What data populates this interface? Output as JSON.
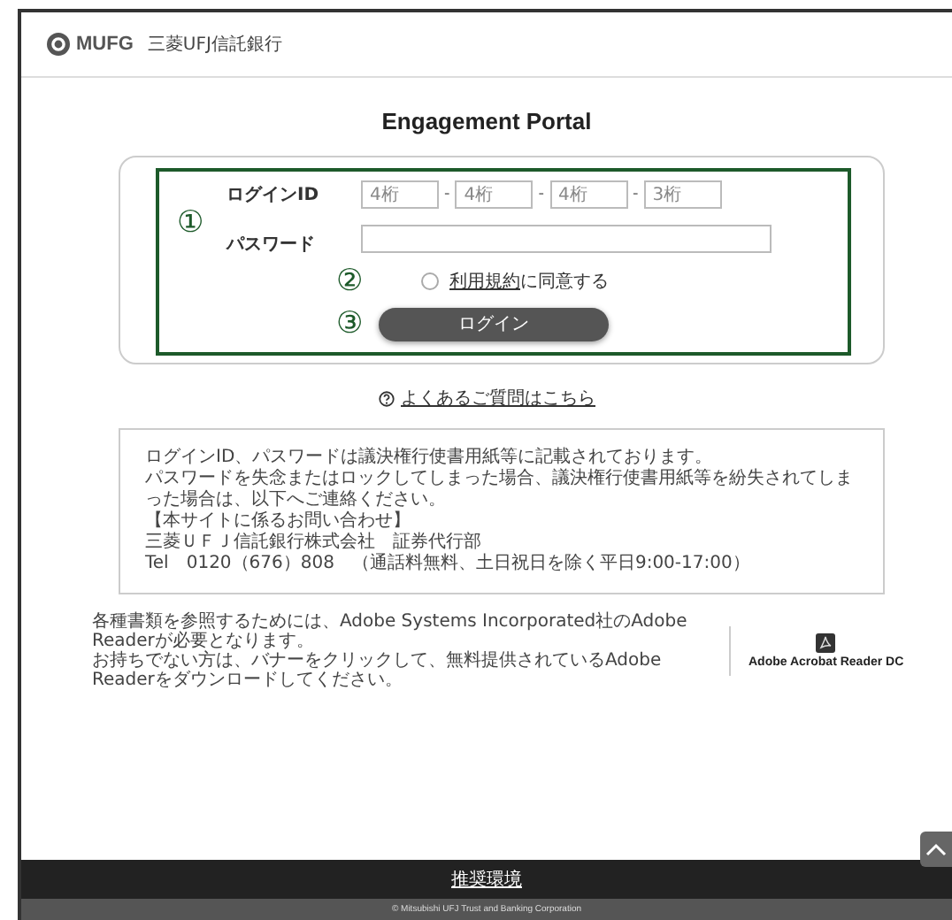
{
  "header": {
    "logo_text": "MUFG",
    "bank_name": "三菱UFJ信託銀行"
  },
  "title": "Engagement Portal",
  "login": {
    "id_label": "ログインID",
    "id_fields": [
      {
        "placeholder": "4桁"
      },
      {
        "placeholder": "4桁"
      },
      {
        "placeholder": "4桁"
      },
      {
        "placeholder": "3桁"
      }
    ],
    "separator": "-",
    "password_label": "パスワード",
    "terms": {
      "checked": false,
      "link": "利用規約",
      "text": "に同意する"
    },
    "button": "ログイン",
    "annotations": [
      "①",
      "②",
      "③"
    ]
  },
  "faq_link": "よくあるご質問はこちら",
  "notice": [
    "ログインID、パスワードは議決権行使書用紙等に記載されております。",
    "パスワードを失念またはロックしてしまった場合、議決権行使書用紙等を紛失されてしまった場合は、以下へご連絡ください。",
    "【本サイトに係るお問い合わせ】",
    "三菱ＵＦＪ信託銀行株式会社　証券代行部",
    "Tel　0120（676）808　（通話料無料、土日祝日を除く平日9:00-17:00）"
  ],
  "adobe": {
    "text": [
      "各種書類を参照するためには、Adobe Systems Incorporated社のAdobe Readerが必要となります。",
      "お持ちでない方は、バナーをクリックして、無料提供されているAdobe Readerをダウンロードしてください。"
    ],
    "banner": "Adobe Acrobat Reader DC"
  },
  "footer": {
    "link": "推奨環境",
    "copyright": "© Mitsubishi UFJ Trust and Banking Corporation"
  }
}
